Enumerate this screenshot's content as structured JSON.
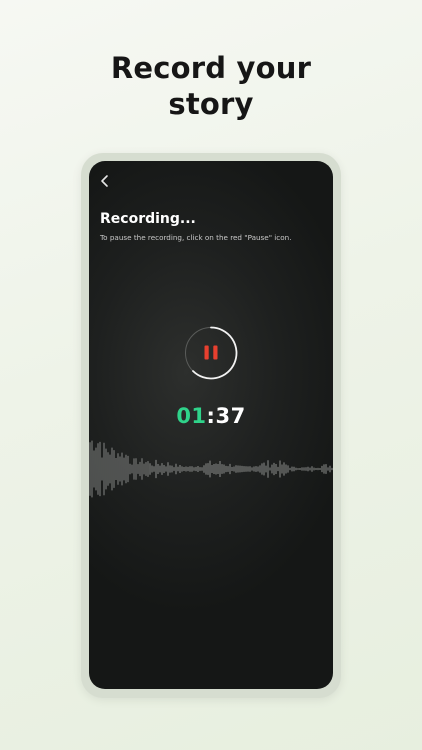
{
  "headline": {
    "line1": "Record your",
    "line2": "story"
  },
  "screen": {
    "back_icon": "chevron-left-icon",
    "title": "Recording...",
    "subtitle": "To pause the recording, click on the red \"Pause\" icon.",
    "pause_icon": "pause-icon",
    "timer": {
      "minutes": "01",
      "separator": ":",
      "seconds": "37"
    }
  },
  "colors": {
    "accent_red": "#e8402f",
    "accent_green": "#2fd38a",
    "screen_bg": "#1e201f",
    "frame": "#d6ddd0"
  }
}
